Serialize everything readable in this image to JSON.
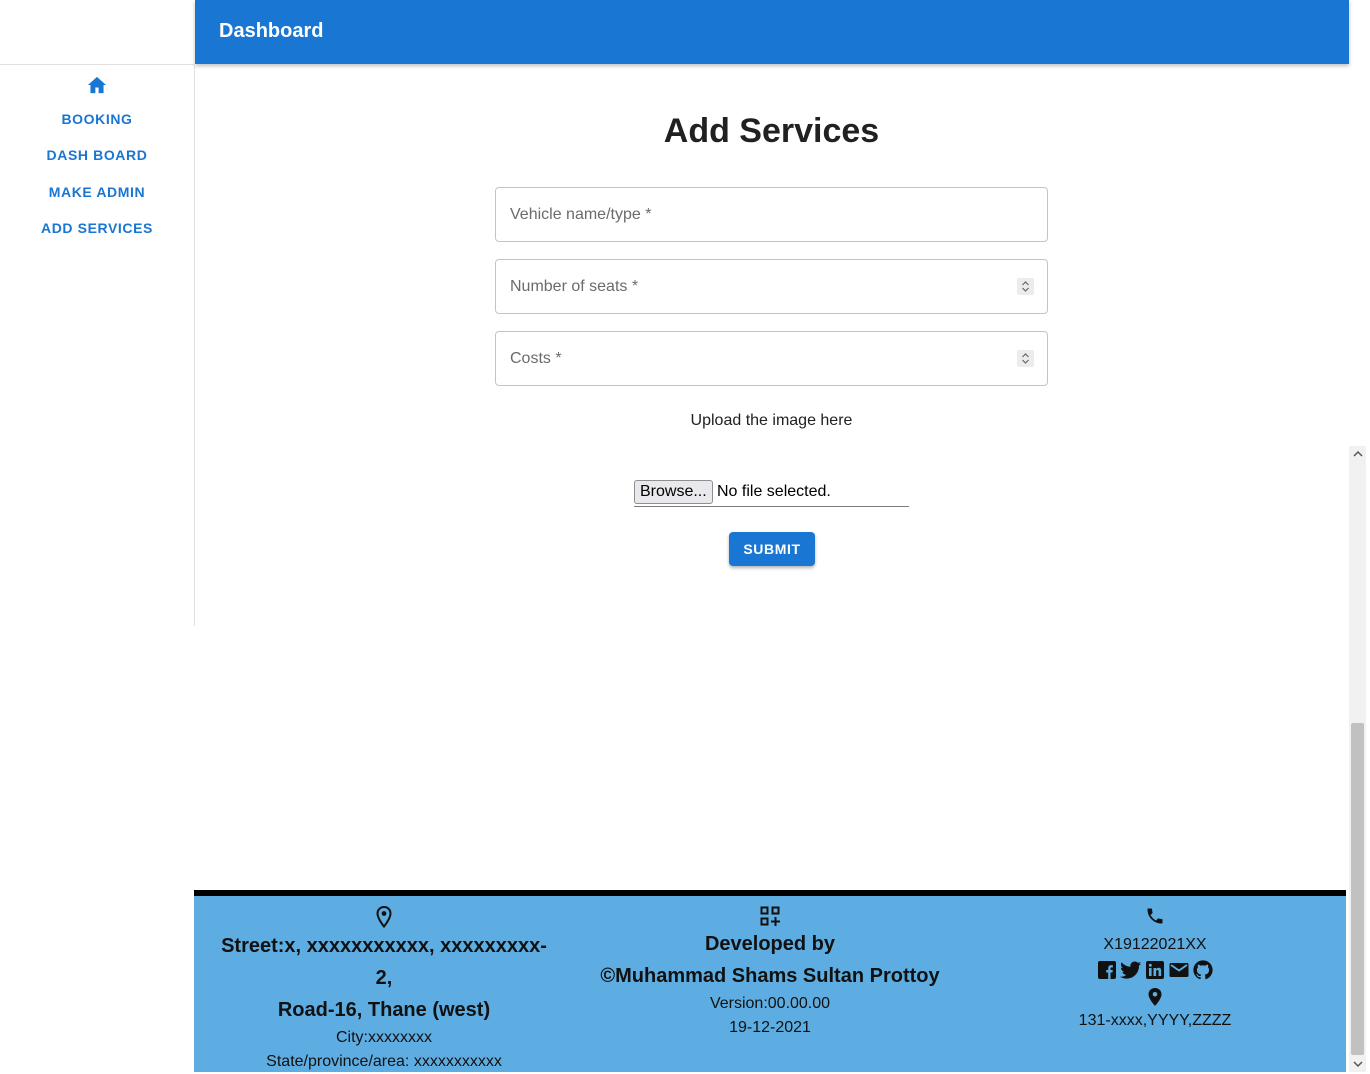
{
  "header": {
    "title": "Dashboard"
  },
  "sidebar": {
    "home_icon": "home-icon",
    "items": [
      {
        "label": "BOOKING"
      },
      {
        "label": "DASH BOARD"
      },
      {
        "label": "MAKE ADMIN"
      },
      {
        "label": "ADD SERVICES"
      }
    ]
  },
  "form": {
    "title": "Add Services",
    "vehicle_placeholder": "Vehicle name/type *",
    "seats_placeholder": "Number of seats *",
    "costs_placeholder": "Costs *",
    "upload_label": "Upload the image here",
    "browse_label": "Browse...",
    "file_status": "No file selected.",
    "submit_label": "SUBMIT"
  },
  "footer": {
    "address": {
      "icon": "location-pin-icon",
      "line1": "Street:x, xxxxxxxxxxx, xxxxxxxxx-2,",
      "line2": "Road-16, Thane (west)",
      "city": "City:xxxxxxxx",
      "state": "State/province/area: xxxxxxxxxxx"
    },
    "developer": {
      "icon": "qr-code-add-icon",
      "heading": "Developed by",
      "name": "©Muhammad Shams Sultan Prottoy",
      "version": "Version:00.00.00",
      "date": "19-12-2021"
    },
    "contact": {
      "icon": "phone-icon",
      "phone": "X19122021XX",
      "socials": [
        "facebook-icon",
        "twitter-icon",
        "linkedin-icon",
        "email-icon",
        "github-icon"
      ],
      "location_icon": "location-icon",
      "location": "131-xxxx,YYYY,ZZZZ"
    }
  },
  "colors": {
    "primary": "#1976d2",
    "footer_bg": "#5dade2",
    "footer_border": "#000000"
  }
}
